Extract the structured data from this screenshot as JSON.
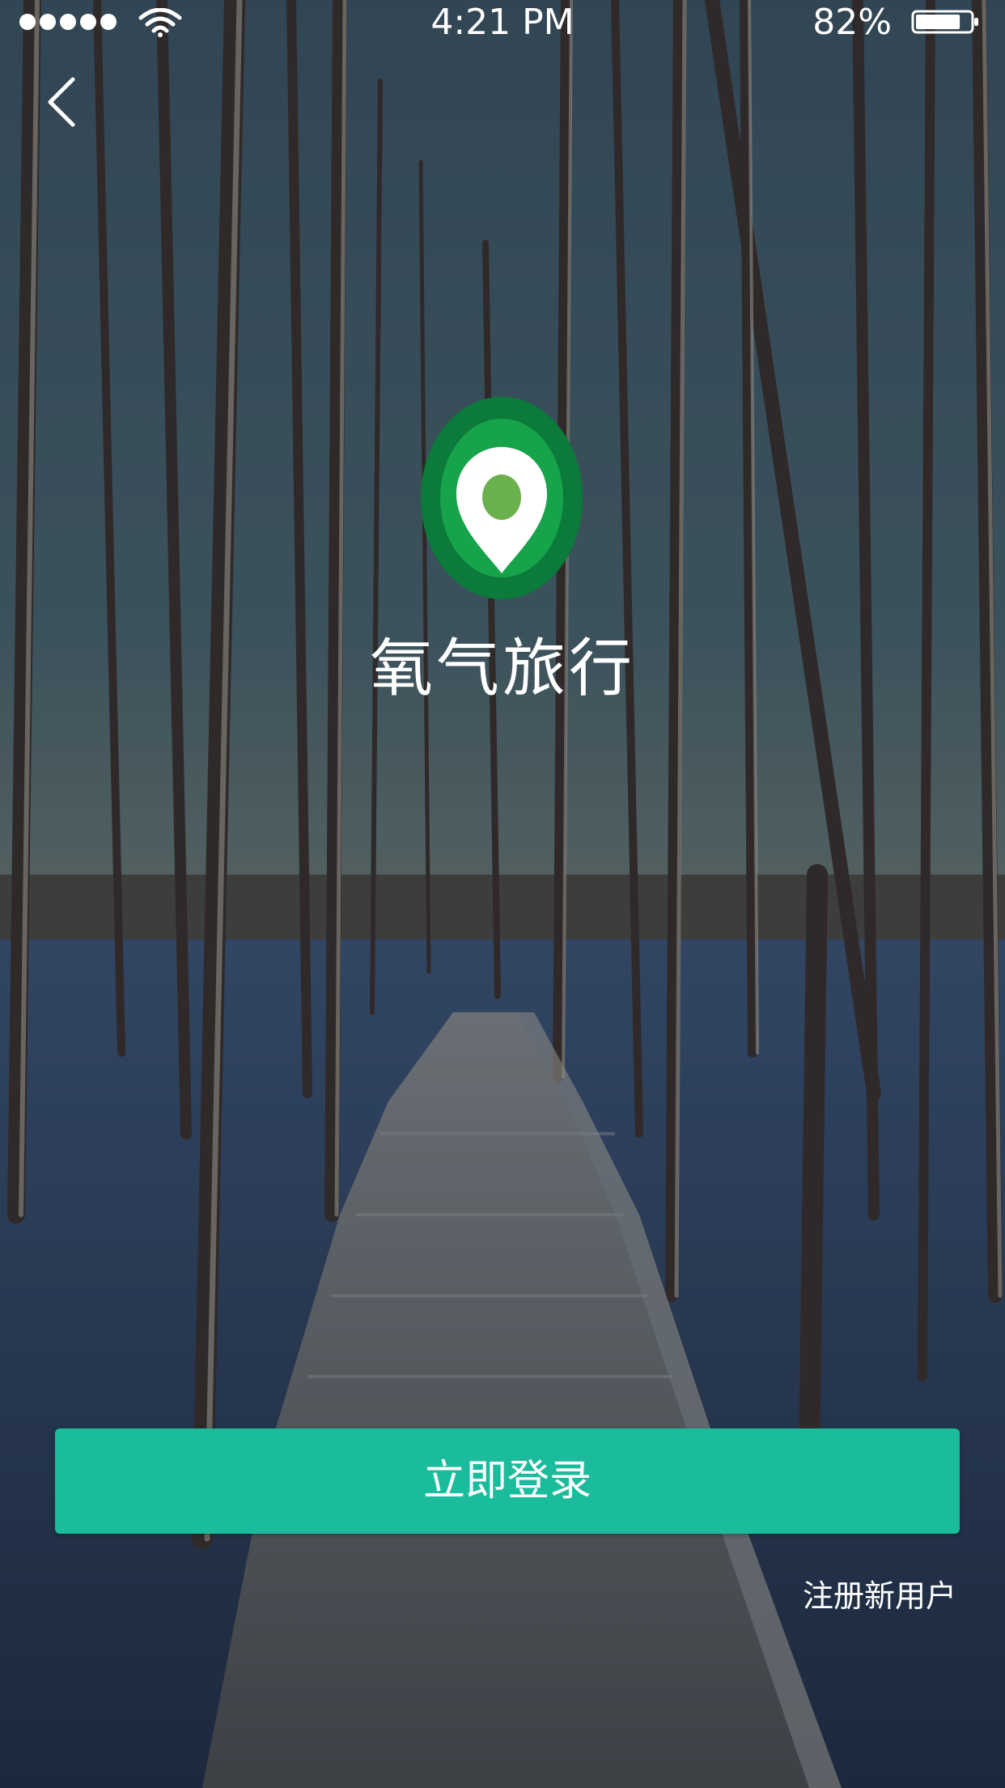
{
  "status_bar": {
    "time": "4:21 PM",
    "battery_percent": "82%",
    "signal_dots": 5,
    "battery_level": 0.82
  },
  "navigation": {
    "back_icon": "chevron-left-icon"
  },
  "brand": {
    "logo_icon": "map-pin-icon",
    "app_name": "氧气旅行",
    "colors": {
      "logo_outer": "#0b7a3a",
      "logo_ring": "#16a34a",
      "logo_dot": "#6ab04c"
    }
  },
  "actions": {
    "login_label": "立即登录",
    "register_label": "注册新用户",
    "accent_color": "#1abc9c"
  }
}
